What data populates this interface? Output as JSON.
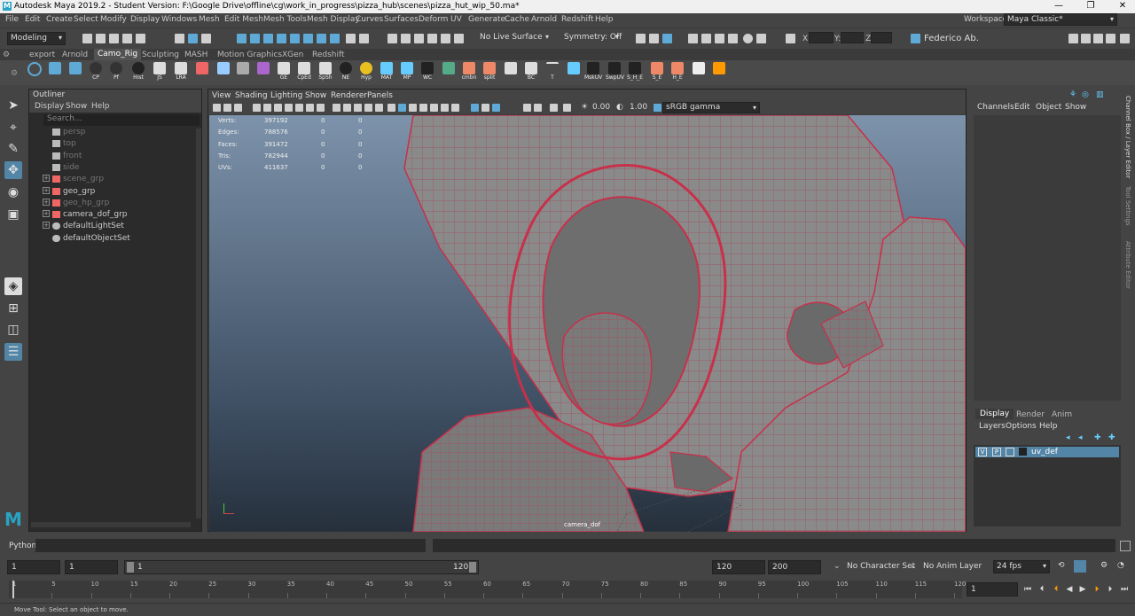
{
  "window": {
    "title": "Autodesk Maya 2019.2 - Student Version: F:\\Google Drive\\offline\\cg\\work_in_progress\\pizza_hub\\scenes\\pizza_hut_wip_50.ma*"
  },
  "menubar": [
    "File",
    "Edit",
    "Create",
    "Select",
    "Modify",
    "Display",
    "Windows",
    "Mesh",
    "Edit Mesh",
    "Mesh Tools",
    "Mesh Display",
    "Curves",
    "Surfaces",
    "Deform",
    "UV",
    "Generate",
    "Cache",
    "Arnold",
    "Redshift",
    "Help"
  ],
  "workspace": {
    "label": "Workspace :",
    "value": "Maya Classic*"
  },
  "statusline": {
    "menuset": "Modeling",
    "live_surface": "No Live Surface",
    "symmetry": "Symmetry: Off",
    "user": "Federico Ab.",
    "x_label": "X:",
    "y_label": "Y:",
    "z_label": "Z:"
  },
  "shelf_tabs": [
    "export",
    "Arnold",
    "Camo_Rig",
    "Sculpting",
    "MASH",
    "Motion Graphics",
    "XGen",
    "Redshift"
  ],
  "shelf_active": "Camo_Rig",
  "shelf_items": [
    "",
    "",
    "",
    "CP",
    "Pf",
    "Hist",
    "JS",
    "LRA",
    "",
    "",
    "",
    "",
    "GE",
    "CpEd",
    "SpSh",
    "NE",
    "Hyp",
    "MAT",
    "MP",
    "WC",
    "",
    "cmbn",
    "split",
    "",
    "BC",
    "T",
    "",
    "MskUV",
    "SwpUV",
    "S_H_E",
    "S_E",
    "H_E",
    "",
    ""
  ],
  "outliner": {
    "title": "Outliner",
    "menu": [
      "Display",
      "Show",
      "Help"
    ],
    "search_placeholder": "Search...",
    "items": [
      {
        "label": "persp",
        "dim": true,
        "expand": false
      },
      {
        "label": "top",
        "dim": true,
        "expand": false
      },
      {
        "label": "front",
        "dim": true,
        "expand": false
      },
      {
        "label": "side",
        "dim": true,
        "expand": false
      },
      {
        "label": "scene_grp",
        "dim": true,
        "expand": true
      },
      {
        "label": "geo_grp",
        "dim": false,
        "expand": true
      },
      {
        "label": "geo_hp_grp",
        "dim": true,
        "expand": true
      },
      {
        "label": "camera_dof_grp",
        "dim": false,
        "expand": true
      },
      {
        "label": "defaultLightSet",
        "dim": false,
        "expand": true
      },
      {
        "label": "defaultObjectSet",
        "dim": false,
        "expand": false
      }
    ]
  },
  "viewport": {
    "menu": [
      "View",
      "Shading",
      "Lighting",
      "Show",
      "Renderer",
      "Panels"
    ],
    "exposure": "0.00",
    "gamma": "1.00",
    "color_space": "sRGB gamma",
    "camera": "camera_dof",
    "hud": [
      {
        "label": "Verts:",
        "v1": "397192",
        "v2": "0",
        "v3": "0"
      },
      {
        "label": "Edges:",
        "v1": "788576",
        "v2": "0",
        "v3": "0"
      },
      {
        "label": "Faces:",
        "v1": "391472",
        "v2": "0",
        "v3": "0"
      },
      {
        "label": "Tris:",
        "v1": "782944",
        "v2": "0",
        "v3": "0"
      },
      {
        "label": "UVs:",
        "v1": "411637",
        "v2": "0",
        "v3": "0"
      }
    ]
  },
  "channels": {
    "menu": [
      "Channels",
      "Edit",
      "Object",
      "Show"
    ]
  },
  "layers": {
    "tabs": [
      "Display",
      "Render",
      "Anim"
    ],
    "menu": [
      "Layers",
      "Options",
      "Help"
    ],
    "layer": {
      "v": "V",
      "p": "P",
      "name": "uv_def"
    }
  },
  "side_tabs": [
    "Channel Box / Layer Editor",
    "Tool Settings",
    "Attribute Editor"
  ],
  "python_label": "Python",
  "range": {
    "start": "1",
    "start2": "1",
    "slider_start": "1",
    "slider_end": "120",
    "end": "120",
    "end2": "200",
    "character_set": "No Character Set",
    "anim_layer": "No Anim Layer",
    "fps": "24 fps"
  },
  "timeline": {
    "ticks": [
      "1",
      "5",
      "10",
      "15",
      "20",
      "25",
      "30",
      "35",
      "40",
      "45",
      "50",
      "55",
      "60",
      "65",
      "70",
      "75",
      "80",
      "85",
      "90",
      "95",
      "100",
      "105",
      "110",
      "115",
      "120"
    ],
    "current": "1"
  },
  "help_line": "Move Tool: Select an object to move."
}
